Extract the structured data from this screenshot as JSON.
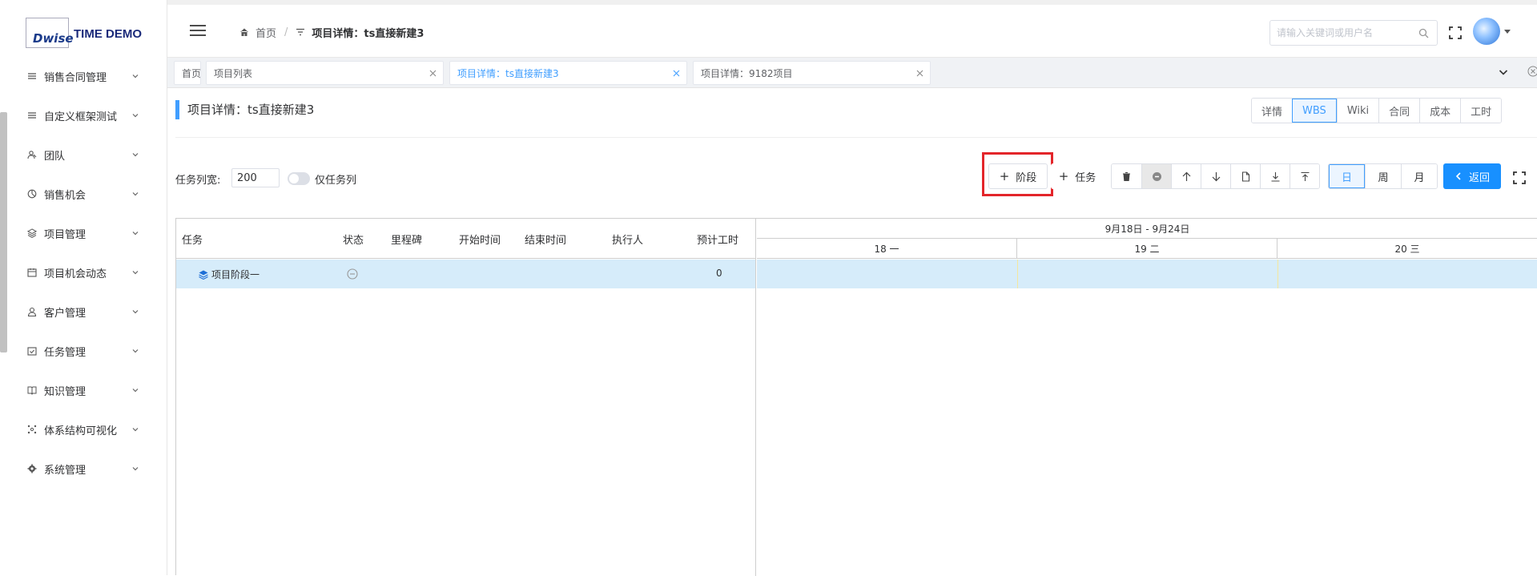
{
  "logo": {
    "mark": "Dwise",
    "text": "TIME DEMO"
  },
  "sidebar": {
    "items": [
      {
        "label": "销售合同管理",
        "icon": "list-icon"
      },
      {
        "label": "自定义框架测试",
        "icon": "list-icon"
      },
      {
        "label": "团队",
        "icon": "team-icon"
      },
      {
        "label": "销售机会",
        "icon": "pie-chart-icon"
      },
      {
        "label": "项目管理",
        "icon": "layers-icon"
      },
      {
        "label": "项目机会动态",
        "icon": "calendar-icon"
      },
      {
        "label": "客户管理",
        "icon": "user-icon"
      },
      {
        "label": "任务管理",
        "icon": "task-icon"
      },
      {
        "label": "知识管理",
        "icon": "book-icon"
      },
      {
        "label": "体系结构可视化",
        "icon": "structure-icon"
      },
      {
        "label": "系统管理",
        "icon": "gear-icon"
      }
    ]
  },
  "header": {
    "breadcrumb": {
      "home": "首页",
      "current": "项目详情：ts直接新建3"
    },
    "search_placeholder": "请输入关键词或用户名"
  },
  "tabs": [
    {
      "label": "首页",
      "active": false
    },
    {
      "label": "项目列表",
      "active": false
    },
    {
      "label": "项目详情：ts直接新建3",
      "active": true
    },
    {
      "label": "项目详情：9182项目",
      "active": false
    }
  ],
  "page": {
    "title": "项目详情：ts直接新建3",
    "view_tabs": [
      "详情",
      "WBS",
      "Wiki",
      "合同",
      "成本",
      "工时"
    ],
    "active_view": "WBS"
  },
  "toolbar": {
    "col_width_label": "任务列宽:",
    "col_width_value": "200",
    "only_tasks_label": "仅任务列",
    "add_stage_label": "阶段",
    "add_task_label": "任务",
    "scale": [
      "日",
      "周",
      "月"
    ],
    "active_scale": "日",
    "back_label": "返回",
    "highlight_color": "#e3252a",
    "accent_color": "#409eff"
  },
  "gantt": {
    "columns": [
      "任务",
      "状态",
      "里程碑",
      "开始时间",
      "结束时间",
      "执行人",
      "预计工时"
    ],
    "rows": [
      {
        "task": "项目阶段一",
        "status_icon": "minus-circle-icon",
        "milestone": "",
        "start": "",
        "end": "",
        "assignee": "",
        "hours": "0"
      }
    ],
    "week_label": "9月18日 - 9月24日",
    "days": [
      "18 一",
      "19 二",
      "20 三"
    ]
  }
}
